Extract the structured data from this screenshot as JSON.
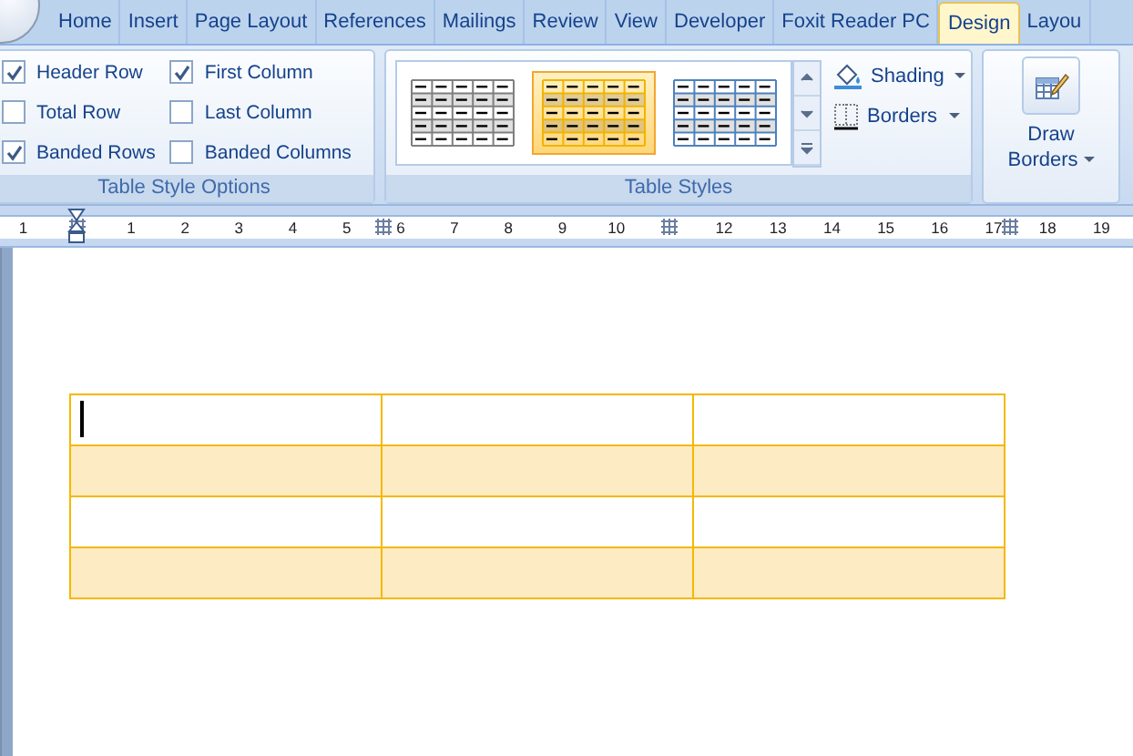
{
  "tabs": [
    {
      "label": "Home",
      "selected": false
    },
    {
      "label": "Insert",
      "selected": false
    },
    {
      "label": "Page Layout",
      "selected": false
    },
    {
      "label": "References",
      "selected": false
    },
    {
      "label": "Mailings",
      "selected": false
    },
    {
      "label": "Review",
      "selected": false
    },
    {
      "label": "View",
      "selected": false
    },
    {
      "label": "Developer",
      "selected": false
    },
    {
      "label": "Foxit Reader PC",
      "selected": false
    },
    {
      "label": "Design",
      "selected": true
    },
    {
      "label": "Layou",
      "selected": false
    }
  ],
  "table_style_options": {
    "title": "Table Style Options",
    "columns": [
      [
        {
          "label": "Header Row",
          "checked": true
        },
        {
          "label": "Total Row",
          "checked": false
        },
        {
          "label": "Banded Rows",
          "checked": true
        }
      ],
      [
        {
          "label": "First Column",
          "checked": true
        },
        {
          "label": "Last Column",
          "checked": false
        },
        {
          "label": "Banded Columns",
          "checked": false
        }
      ]
    ]
  },
  "table_styles": {
    "title": "Table Styles",
    "styles": [
      {
        "color": "#7f7f7f",
        "selected": false
      },
      {
        "color": "#f0b400",
        "selected": true
      },
      {
        "color": "#4f81bd",
        "selected": false
      }
    ],
    "commands": [
      {
        "kind": "shading",
        "label": "Shading"
      },
      {
        "kind": "borders",
        "label": "Borders"
      }
    ]
  },
  "draw_borders": {
    "label_lines": [
      "Draw",
      "Borders"
    ]
  },
  "ruler": [
    {
      "kind": "number",
      "label": "1"
    },
    {
      "kind": "marker"
    },
    {
      "kind": "number",
      "label": "1"
    },
    {
      "kind": "number",
      "label": "2"
    },
    {
      "kind": "number",
      "label": "3"
    },
    {
      "kind": "number",
      "label": "4"
    },
    {
      "kind": "number",
      "label": "5"
    },
    {
      "kind": "number",
      "label": "6"
    },
    {
      "kind": "number",
      "label": "7"
    },
    {
      "kind": "number",
      "label": "8"
    },
    {
      "kind": "number",
      "label": "9"
    },
    {
      "kind": "number",
      "label": "10"
    },
    {
      "kind": "marker"
    },
    {
      "kind": "number",
      "label": "12"
    },
    {
      "kind": "number",
      "label": "13"
    },
    {
      "kind": "number",
      "label": "14"
    },
    {
      "kind": "number",
      "label": "15"
    },
    {
      "kind": "number",
      "label": "16"
    },
    {
      "kind": "number",
      "label": "17"
    },
    {
      "kind": "number",
      "label": "18"
    },
    {
      "kind": "number",
      "label": "19"
    }
  ],
  "document_table": {
    "rows": [
      {
        "shaded": false,
        "cells": [
          {
            "cursor": true
          },
          {
            "cursor": false
          },
          {
            "cursor": false
          }
        ]
      },
      {
        "shaded": true,
        "cells": [
          {
            "cursor": false
          },
          {
            "cursor": false
          },
          {
            "cursor": false
          }
        ]
      },
      {
        "shaded": false,
        "cells": [
          {
            "cursor": false
          },
          {
            "cursor": false
          },
          {
            "cursor": false
          }
        ]
      },
      {
        "shaded": true,
        "cells": [
          {
            "cursor": false
          },
          {
            "cursor": false
          },
          {
            "cursor": false
          }
        ]
      }
    ]
  }
}
